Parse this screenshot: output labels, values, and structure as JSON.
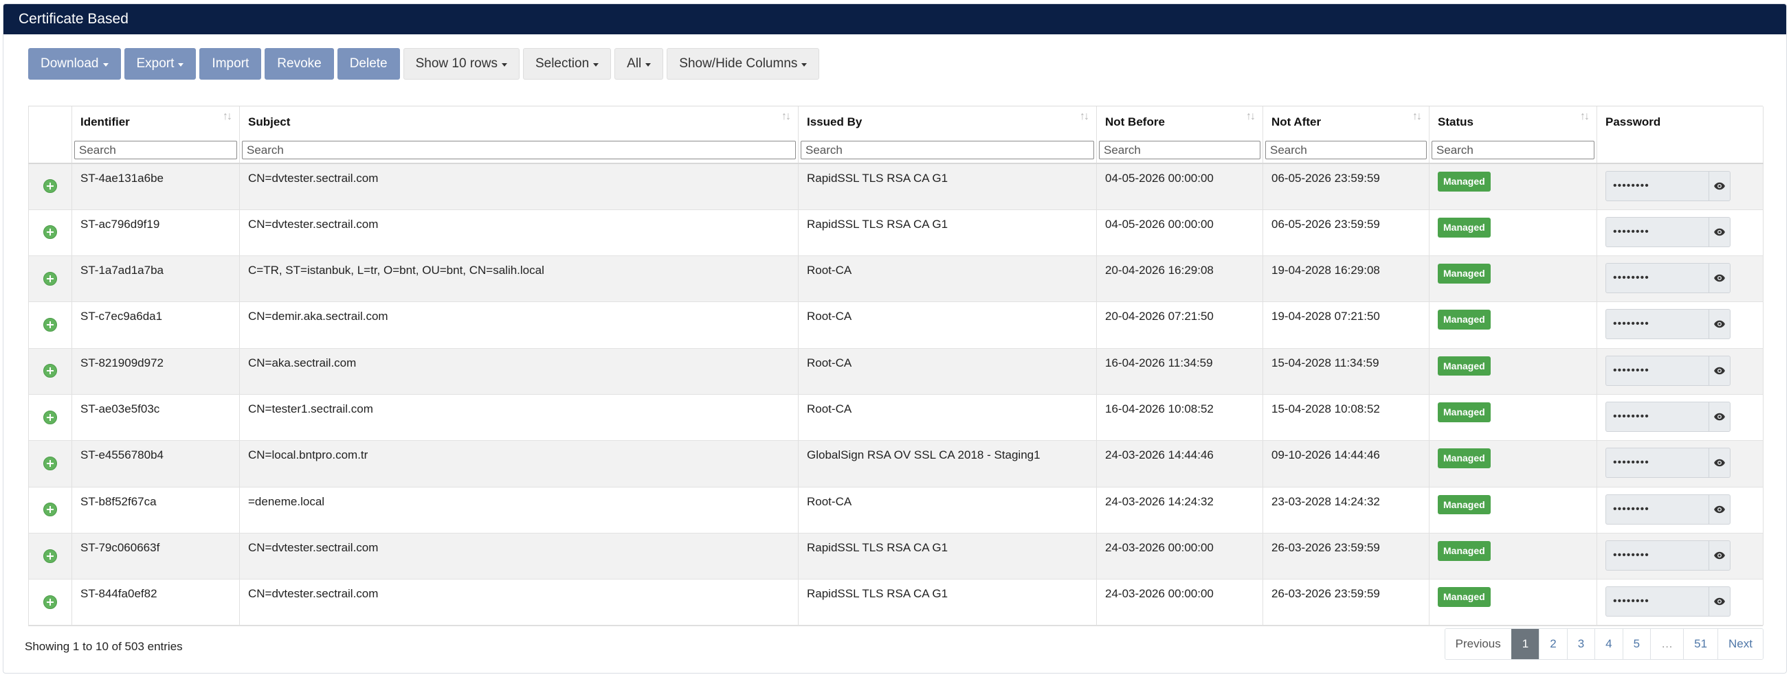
{
  "panel": {
    "title": "Certificate Based"
  },
  "toolbar": {
    "buttons": [
      {
        "label": "Download",
        "dropdown": true,
        "style": "blue"
      },
      {
        "label": "Export",
        "dropdown": true,
        "style": "blue"
      },
      {
        "label": "Import",
        "dropdown": false,
        "style": "blue"
      },
      {
        "label": "Revoke",
        "dropdown": false,
        "style": "blue"
      },
      {
        "label": "Delete",
        "dropdown": false,
        "style": "blue"
      },
      {
        "label": "Show 10 rows",
        "dropdown": true,
        "style": "gray"
      },
      {
        "label": "Selection",
        "dropdown": true,
        "style": "gray"
      },
      {
        "label": "All",
        "dropdown": true,
        "style": "gray"
      },
      {
        "label": "Show/Hide Columns",
        "dropdown": true,
        "style": "gray"
      }
    ]
  },
  "table": {
    "columns": [
      {
        "key": "expand",
        "label": "",
        "sortable": false,
        "searchable": false
      },
      {
        "key": "identifier",
        "label": "Identifier",
        "sortable": true,
        "searchable": true
      },
      {
        "key": "subject",
        "label": "Subject",
        "sortable": true,
        "searchable": true
      },
      {
        "key": "issued_by",
        "label": "Issued By",
        "sortable": true,
        "searchable": true
      },
      {
        "key": "not_before",
        "label": "Not Before",
        "sortable": true,
        "searchable": true
      },
      {
        "key": "not_after",
        "label": "Not After",
        "sortable": true,
        "searchable": true
      },
      {
        "key": "status",
        "label": "Status",
        "sortable": true,
        "searchable": true
      },
      {
        "key": "password",
        "label": "Password",
        "sortable": false,
        "searchable": false
      }
    ],
    "search_placeholder": "Search",
    "sort_glyph": "↑↓",
    "rows": [
      {
        "identifier": "ST-4ae131a6be",
        "subject": "CN=dvtester.sectrail.com",
        "issued_by": "RapidSSL TLS RSA CA G1",
        "not_before": "04-05-2026 00:00:00",
        "not_after": "06-05-2026 23:59:59",
        "status": "Managed",
        "password": "••••••••"
      },
      {
        "identifier": "ST-ac796d9f19",
        "subject": "CN=dvtester.sectrail.com",
        "issued_by": "RapidSSL TLS RSA CA G1",
        "not_before": "04-05-2026 00:00:00",
        "not_after": "06-05-2026 23:59:59",
        "status": "Managed",
        "password": "••••••••"
      },
      {
        "identifier": "ST-1a7ad1a7ba",
        "subject": "C=TR, ST=istanbuk, L=tr, O=bnt, OU=bnt, CN=salih.local",
        "issued_by": "Root-CA",
        "not_before": "20-04-2026 16:29:08",
        "not_after": "19-04-2028 16:29:08",
        "status": "Managed",
        "password": "••••••••"
      },
      {
        "identifier": "ST-c7ec9a6da1",
        "subject": "CN=demir.aka.sectrail.com",
        "issued_by": "Root-CA",
        "not_before": "20-04-2026 07:21:50",
        "not_after": "19-04-2028 07:21:50",
        "status": "Managed",
        "password": "••••••••"
      },
      {
        "identifier": "ST-821909d972",
        "subject": "CN=aka.sectrail.com",
        "issued_by": "Root-CA",
        "not_before": "16-04-2026 11:34:59",
        "not_after": "15-04-2028 11:34:59",
        "status": "Managed",
        "password": "••••••••"
      },
      {
        "identifier": "ST-ae03e5f03c",
        "subject": "CN=tester1.sectrail.com",
        "issued_by": "Root-CA",
        "not_before": "16-04-2026 10:08:52",
        "not_after": "15-04-2028 10:08:52",
        "status": "Managed",
        "password": "••••••••"
      },
      {
        "identifier": "ST-e4556780b4",
        "subject": "CN=local.bntpro.com.tr",
        "issued_by": "GlobalSign RSA OV SSL CA 2018 - Staging1",
        "not_before": "24-03-2026 14:44:46",
        "not_after": "09-10-2026 14:44:46",
        "status": "Managed",
        "password": "••••••••"
      },
      {
        "identifier": "ST-b8f52f67ca",
        "subject": "=deneme.local",
        "issued_by": "Root-CA",
        "not_before": "24-03-2026 14:24:32",
        "not_after": "23-03-2028 14:24:32",
        "status": "Managed",
        "password": "••••••••"
      },
      {
        "identifier": "ST-79c060663f",
        "subject": "CN=dvtester.sectrail.com",
        "issued_by": "RapidSSL TLS RSA CA G1",
        "not_before": "24-03-2026 00:00:00",
        "not_after": "26-03-2026 23:59:59",
        "status": "Managed",
        "password": "••••••••"
      },
      {
        "identifier": "ST-844fa0ef82",
        "subject": "CN=dvtester.sectrail.com",
        "issued_by": "RapidSSL TLS RSA CA G1",
        "not_before": "24-03-2026 00:00:00",
        "not_after": "26-03-2026 23:59:59",
        "status": "Managed",
        "password": "••••••••"
      }
    ]
  },
  "footer": {
    "info": "Showing 1 to 10 of 503 entries",
    "pagination": [
      {
        "label": "Previous",
        "state": "disabled"
      },
      {
        "label": "1",
        "state": "active"
      },
      {
        "label": "2",
        "state": "normal"
      },
      {
        "label": "3",
        "state": "normal"
      },
      {
        "label": "4",
        "state": "normal"
      },
      {
        "label": "5",
        "state": "normal"
      },
      {
        "label": "…",
        "state": "ellipsis"
      },
      {
        "label": "51",
        "state": "normal"
      },
      {
        "label": "Next",
        "state": "normal"
      }
    ]
  },
  "icons": {
    "expand": "plus-circle-icon",
    "reveal": "eye-icon",
    "caret": "caret-down-icon",
    "sort": "sort-icon"
  },
  "colors": {
    "header_bg": "#0b1f45",
    "primary_btn": "#7b93bd",
    "status_badge": "#4ba34b",
    "expand_icon": "#62b45e",
    "active_page": "#6c757d"
  }
}
